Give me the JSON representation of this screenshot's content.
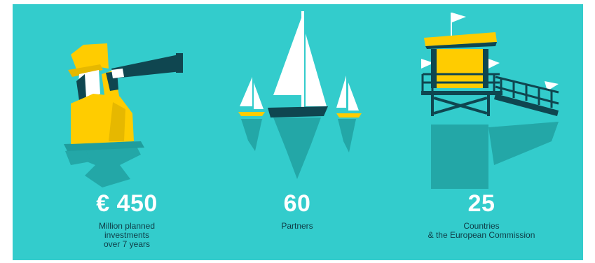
{
  "colors": {
    "background": "#33cccc",
    "dark_teal": "#0f4650",
    "shadow_teal": "#23a7a7",
    "yellow": "#ffcc00",
    "white": "#ffffff"
  },
  "stats": [
    {
      "value": "€ 450",
      "label": "Million planned\ninvestments\nover 7 years",
      "illustration": "figure-with-telescope-icon"
    },
    {
      "value": "60",
      "label": "Partners",
      "illustration": "sailboats-icon"
    },
    {
      "value": "25",
      "label": "Countries\n& the European Commission",
      "illustration": "lifeguard-tower-icon"
    }
  ]
}
